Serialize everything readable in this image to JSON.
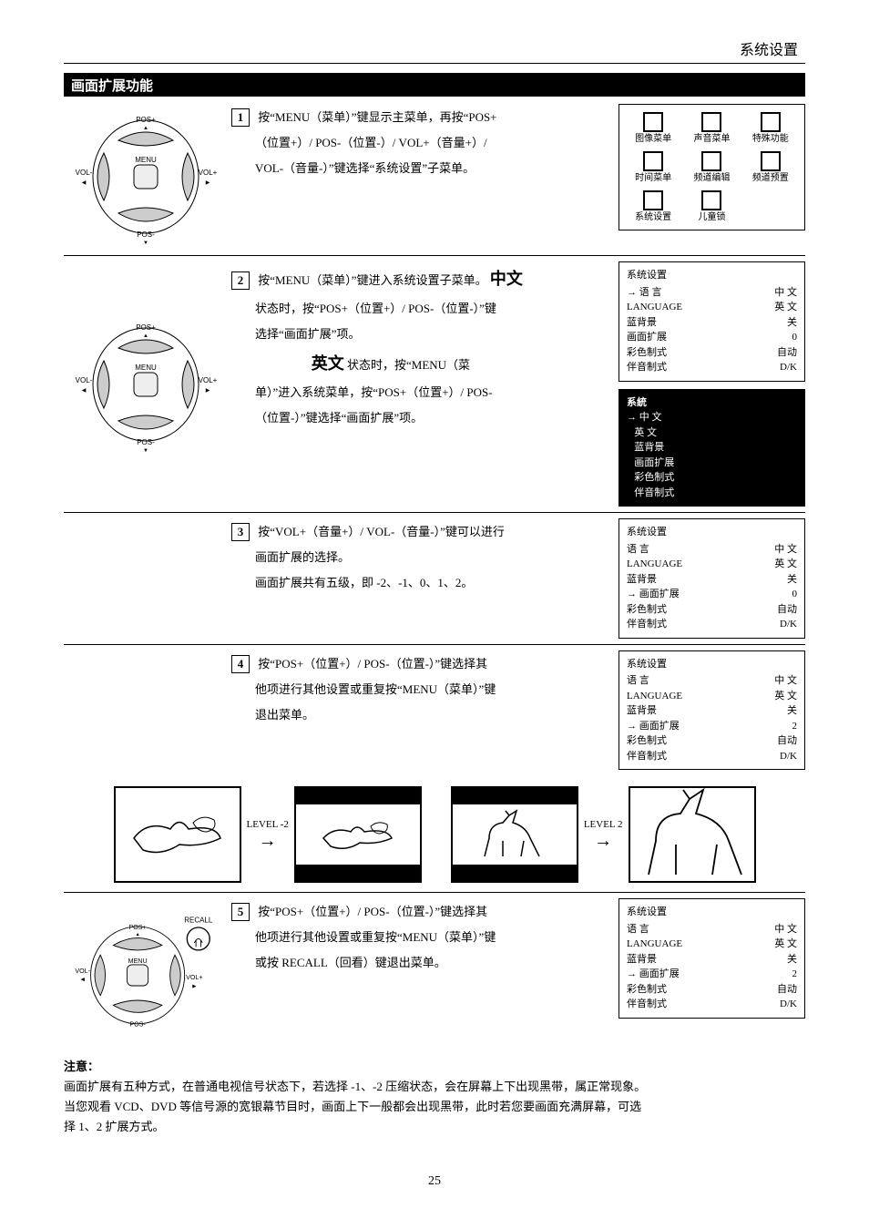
{
  "header": "系统设置",
  "section_title": "画面扩展功能",
  "remote": {
    "pos_plus": "POS+",
    "pos_minus": "POS-",
    "vol_plus": "VOL+",
    "vol_minus": "VOL-",
    "menu": "MENU",
    "recall": "RECALL"
  },
  "menu_grid": {
    "items": [
      "图像菜单",
      "声音菜单",
      "特殊功能",
      "时间菜单",
      "频道编辑",
      "频道预置",
      "系统设置",
      "儿童锁"
    ]
  },
  "step1": {
    "num": "1",
    "line1": "按“MENU（菜单）”键显示主菜单，再按“POS+",
    "line2": "（位置+）/ POS-（位置-）/ VOL+（音量+）/",
    "line3": "VOL-（音量-）”键选择“系统设置”子菜单。"
  },
  "step2": {
    "num": "2",
    "line1_a": "按“MENU（菜单）”键进入系统设置子菜单。",
    "line1_b": "中文",
    "line2": "状态时，按“POS+（位置+）/ POS-（位置-）”键",
    "line3": "选择“画面扩展”项。",
    "line_en_label": "英文",
    "line_en_tail": "状态时，按“MENU（菜",
    "line4": "单）”进入系统菜单，按“POS+（位置+）/ POS-",
    "line5": "（位置-）”键选择“画面扩展”项。"
  },
  "step3": {
    "num": "3",
    "line1": "按“VOL+（音量+）/ VOL-（音量-）”键可以进行",
    "line2": "画面扩展的选择。",
    "line3": "画面扩展共有五级，即 -2、-1、0、1、2。"
  },
  "step4": {
    "num": "4",
    "line1": "按“POS+（位置+）/  POS-（位置-）”键选择其",
    "line2": "他项进行其他设置或重复按“MENU（菜单）”键",
    "line3": "退出菜单。"
  },
  "zoom": {
    "level_minus2": "LEVEL -2",
    "level_plus2": "LEVEL 2"
  },
  "step5": {
    "num": "5",
    "line1": "按“POS+（位置+）/  POS-（位置-）”键选择其",
    "line2": "他项进行其他设置或重复按“MENU（菜单）”键",
    "line3": "或按 RECALL（回看）键退出菜单。"
  },
  "note": {
    "title": "注意：",
    "l1": "画面扩展有五种方式，在普通电视信号状态下，若选择 -1、-2 压缩状态，会在屏幕上下出现黑带，属正常现象。",
    "l2": "当您观看 VCD、DVD 等信号源的宽银幕节目时，画面上下一般都会出现黑带，此时若您要画面充满屏幕，可选",
    "l3": "择 1、2 扩展方式。"
  },
  "osd": {
    "box1": {
      "title": "系统设置",
      "rows": [
        {
          "l": "→ 语    言",
          "r": "中 文"
        },
        {
          "l": "LANGUAGE",
          "r": "英 文"
        },
        {
          "l": "蓝背景",
          "r": "关"
        },
        {
          "l": "画面扩展",
          "r": "0"
        },
        {
          "l": "彩色制式",
          "r": "自动"
        },
        {
          "l": "伴音制式",
          "r": "D/K"
        }
      ]
    },
    "box2_header": "系統",
    "box2_items": [
      "中   文",
      "英   文",
      "蓝背景",
      "画面扩展",
      "彩色制式",
      "伴音制式"
    ],
    "box3": {
      "title": "系统设置",
      "rows": [
        {
          "l": "   语    言",
          "r": "中 文"
        },
        {
          "l": "   LANGUAGE",
          "r": "英 文"
        },
        {
          "l": "   蓝背景",
          "r": "关"
        },
        {
          "l": "→ 画面扩展",
          "r": "0"
        },
        {
          "l": "   彩色制式",
          "r": "自动"
        },
        {
          "l": "   伴音制式",
          "r": "D/K"
        }
      ]
    },
    "box4": {
      "title": "系统设置",
      "rows": [
        {
          "l": "   语    言",
          "r": "中 文"
        },
        {
          "l": "   LANGUAGE",
          "r": "英 文"
        },
        {
          "l": "   蓝背景",
          "r": "关"
        },
        {
          "l": "→ 画面扩展",
          "r": "2"
        },
        {
          "l": "   彩色制式",
          "r": "自动"
        },
        {
          "l": "   伴音制式",
          "r": "D/K"
        }
      ]
    },
    "box5": {
      "title": "系统设置",
      "rows": [
        {
          "l": "   语    言",
          "r": "中 文"
        },
        {
          "l": "   LANGUAGE",
          "r": "英 文"
        },
        {
          "l": "   蓝背景",
          "r": "关"
        },
        {
          "l": "→ 画面扩展",
          "r": "2"
        },
        {
          "l": "   彩色制式",
          "r": "自动"
        },
        {
          "l": "   伴音制式",
          "r": "D/K"
        }
      ]
    }
  },
  "page_number": "25"
}
